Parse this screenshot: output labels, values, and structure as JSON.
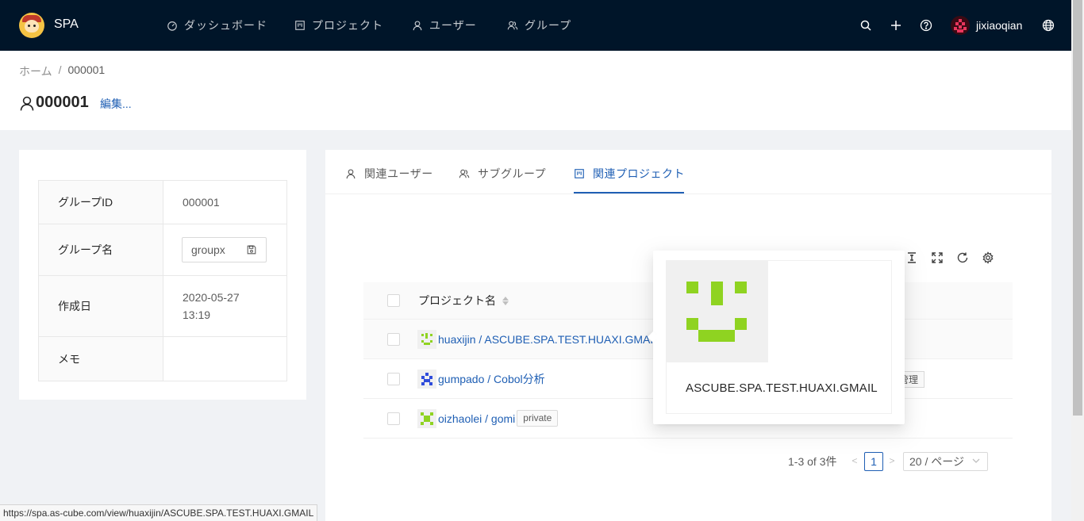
{
  "app": {
    "brand": "SPA"
  },
  "nav": [
    {
      "label": "ダッシュボード",
      "icon": "dashboard-icon"
    },
    {
      "label": "プロジェクト",
      "icon": "project-icon"
    },
    {
      "label": "ユーザー",
      "icon": "user-icon"
    },
    {
      "label": "グループ",
      "icon": "team-icon"
    }
  ],
  "header_icons": [
    "search-icon",
    "plus-icon",
    "help-icon",
    "globe-icon"
  ],
  "user": {
    "name": "jixiaoqian"
  },
  "breadcrumb": {
    "home": "ホーム",
    "separator": "/",
    "current": "000001"
  },
  "page": {
    "title": "000001",
    "edit_label": "編集..."
  },
  "group_info": {
    "id_label": "グループID",
    "id_value": "000001",
    "name_label": "グループ名",
    "name_value": "groupx",
    "created_label": "作成日",
    "created_date": "2020-05-27",
    "created_time": "13:19",
    "memo_label": "メモ",
    "memo_value": ""
  },
  "tabs": [
    {
      "label": "関連ユーザー",
      "active": false
    },
    {
      "label": "サブグループ",
      "active": false
    },
    {
      "label": "関連プロジェクト",
      "active": true
    }
  ],
  "table": {
    "column_name": "プロジェクト名",
    "rows": [
      {
        "name": "huaxijin / ASCUBE.SPA.TEST.HUAXI.GMAIL",
        "tag": ""
      },
      {
        "name": "gumpado / Cobol分析",
        "tag": "管理"
      },
      {
        "name": "oizhaolei / gomi",
        "tag": "private"
      }
    ]
  },
  "pagination": {
    "total": "1-3 of 3件",
    "current": "1",
    "size": "20 / ページ",
    "prev": "<",
    "next": ">"
  },
  "popover": {
    "title": "ASCUBE.SPA.TEST.HUAXI.GMAIL"
  },
  "statusbar": {
    "url": "https://spa.as-cube.com/view/huaxijin/ASCUBE.SPA.TEST.HUAXI.GMAIL"
  },
  "colors": {
    "header_bg": "#001529",
    "primary": "#1f5fb4",
    "avatar_green": "#8fd321",
    "page_bg": "#f0f2f5"
  }
}
